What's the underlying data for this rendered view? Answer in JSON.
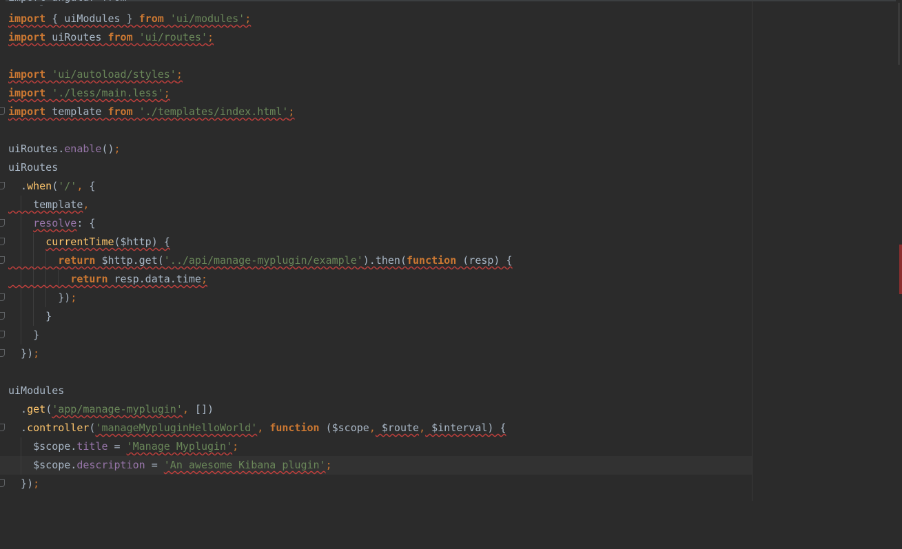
{
  "top_cut_text": "import angular from 'angular';",
  "lines": {
    "l1": [
      "import",
      " { uiModules } ",
      "from",
      " ",
      "'ui/modules'",
      ";"
    ],
    "l2": [
      "import",
      " uiRoutes ",
      "from",
      " ",
      "'ui/routes'",
      ";"
    ],
    "l4": [
      "import",
      " ",
      "'ui/autoload/styles'",
      ";"
    ],
    "l5": [
      "import",
      " ",
      "'./less/main.less'",
      ";"
    ],
    "l6": [
      "import",
      " template ",
      "from",
      " ",
      "'./templates/index.html'",
      ";"
    ],
    "l8": [
      "uiRoutes.",
      "enable",
      "()",
      ";"
    ],
    "l9": [
      "uiRoutes"
    ],
    "l10": [
      "  .",
      "when",
      "(",
      "'/'",
      ",",
      " {"
    ],
    "l11": [
      "    template",
      ","
    ],
    "l12": [
      "    ",
      "resolve",
      ": {"
    ],
    "l13": [
      "      ",
      "currentTime",
      "($http) {"
    ],
    "l14": [
      "        ",
      "return",
      " $http.get(",
      "'../api/manage-myplugin/example'",
      ").then(",
      "function",
      " (resp) {"
    ],
    "l15": [
      "          ",
      "return",
      " resp.data.time",
      ";"
    ],
    "l16": [
      "        })",
      ";"
    ],
    "l17": [
      "      }"
    ],
    "l18": [
      "    }"
    ],
    "l19": [
      "  })",
      ";"
    ],
    "l21": [
      "uiModules"
    ],
    "l22": [
      "  .",
      "get",
      "(",
      "'app/manage-myplugin'",
      ",",
      " [])"
    ],
    "l23": [
      "  .",
      "controller",
      "(",
      "'manageMypluginHelloWorld'",
      ",",
      " ",
      "function",
      " ($scope",
      ",",
      " $route",
      ",",
      " $interval) {"
    ],
    "l24": [
      "    $scope.",
      "title",
      " = ",
      "'Manage Myplugin'",
      ";"
    ],
    "l25": [
      "    $scope.",
      "description",
      " = ",
      "'An awesome Kibana plugin'",
      ";"
    ],
    "l26": [
      "  })",
      ";"
    ]
  }
}
